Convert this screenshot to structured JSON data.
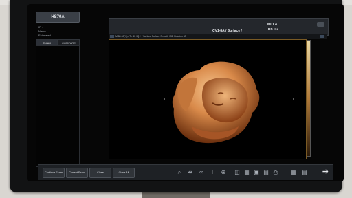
{
  "device": {
    "model": "HS70A",
    "patient_lines": [
      "ID :",
      "Name :",
      "Estimated"
    ]
  },
  "left_tabs": [
    {
      "label": "EXAM",
      "active": true
    },
    {
      "label": "COMPARE",
      "active": false
    }
  ],
  "header": {
    "probe": "CV1-8A / Surface /",
    "mi_label": "MI  1.4",
    "tib_label": "TIb 0.2",
    "params": "M 88 60(%) / Th 40 / Q + / Surface Surface Smooth / 3D Rotation 80"
  },
  "footer": {
    "buttons": [
      "Continue Exam",
      "Current Exam",
      "Close",
      "Close All"
    ],
    "tools": [
      "magnify-icon",
      "resize-icon",
      "link-icon",
      "text-icon",
      "globe-icon",
      "sound-icon",
      "grid-icon",
      "cube-icon",
      "image-icon",
      "print-icon",
      "layout-icon",
      "split-icon",
      "next-arrow-icon"
    ],
    "tool_glyphs": [
      "⌕",
      "⇹",
      "∞",
      "T",
      "⊕",
      "◫",
      "▦",
      "▣",
      "▤",
      "⎙",
      "▦",
      "▤",
      "➔"
    ]
  },
  "colors": {
    "render_highlight": "#e6a769",
    "render_shadow": "#6b2f0e",
    "frame": "#7a5a24"
  }
}
